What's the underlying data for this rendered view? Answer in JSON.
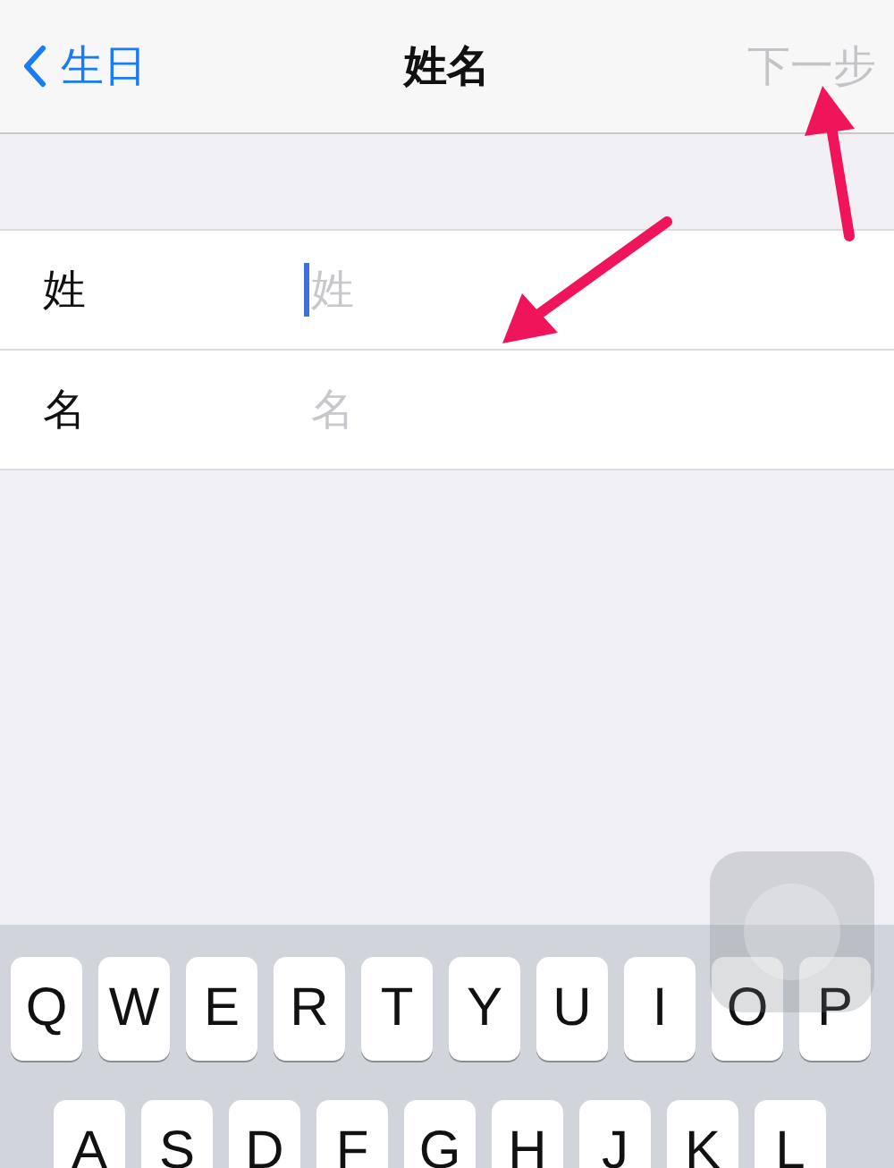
{
  "nav_bar": {
    "back_label": "生日",
    "title": "姓名",
    "next_label": "下一步",
    "next_disabled": true
  },
  "fields": [
    {
      "label": "姓",
      "placeholder": "姓",
      "focused": true
    },
    {
      "label": "名",
      "placeholder": "名",
      "focused": false
    }
  ],
  "keyboard": {
    "rows": [
      [
        "Q",
        "W",
        "E",
        "R",
        "T",
        "Y",
        "U",
        "I",
        "O",
        "P"
      ],
      [
        "A",
        "S",
        "D",
        "F",
        "G",
        "H",
        "J",
        "K",
        "L"
      ]
    ]
  }
}
